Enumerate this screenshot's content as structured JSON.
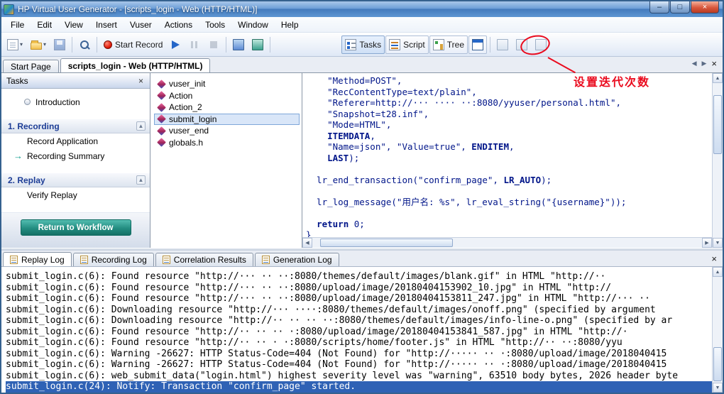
{
  "window": {
    "title": "HP Virtual User Generator - [scripts_login - Web (HTTP/HTML)]"
  },
  "glyphs": {
    "minimize": "–",
    "maximize": "□",
    "close": "×",
    "dropdown": "▾",
    "tab_back": "◀",
    "tab_forward": "▶",
    "collapse": "▲",
    "current_arrow": "→",
    "scroll_up": "▲",
    "scroll_down": "▼",
    "scroll_left": "◀",
    "scroll_right": "▶"
  },
  "menu": {
    "items": [
      "File",
      "Edit",
      "View",
      "Insert",
      "Vuser",
      "Actions",
      "Tools",
      "Window",
      "Help"
    ]
  },
  "toolbar": {
    "start_record_label": "Start Record",
    "tasks_label": "Tasks",
    "script_label": "Script",
    "tree_label": "Tree",
    "annotation_text": "设置迭代次数",
    "annotation_color": "#ea0b1e"
  },
  "document_tabs": [
    {
      "label": "Start Page",
      "active": false
    },
    {
      "label": "scripts_login - Web (HTTP/HTML)",
      "active": true
    }
  ],
  "tasks_panel": {
    "title": "Tasks",
    "entries": [
      {
        "type": "item",
        "label": "Introduction",
        "icon": "intro"
      },
      {
        "type": "section",
        "label": "1. Recording"
      },
      {
        "type": "item",
        "label": "Record Application"
      },
      {
        "type": "item",
        "label": "Recording Summary",
        "current": true
      },
      {
        "type": "section",
        "label": "2. Replay"
      },
      {
        "type": "item",
        "label": "Verify Replay"
      }
    ],
    "workflow_button_label": "Return to Workflow"
  },
  "script_files": [
    {
      "name": "vuser_init",
      "selected": false
    },
    {
      "name": "Action",
      "selected": false
    },
    {
      "name": "Action_2",
      "selected": false
    },
    {
      "name": "submit_login",
      "selected": true
    },
    {
      "name": "vuser_end",
      "selected": false
    },
    {
      "name": "globals.h",
      "selected": false
    }
  ],
  "editor": {
    "keywords": [
      "ITEMDATA",
      "ENDITEM",
      "LAST",
      "LR_AUTO",
      "return"
    ],
    "lines": [
      "    \"Method=POST\",",
      "    \"RecContentType=text/plain\",",
      "    \"Referer=http://··· ···· ··:8080/yyuser/personal.html\",",
      "    \"Snapshot=t28.inf\",",
      "    \"Mode=HTML\",",
      "    ITEMDATA,",
      "    \"Name=json\", \"Value=true\", ENDITEM,",
      "    LAST);",
      "",
      "  lr_end_transaction(\"confirm_page\", LR_AUTO);",
      "",
      "  lr_log_message(\"用户名: %s\", lr_eval_string(\"{username}\"));",
      "",
      "  return 0;",
      "}"
    ]
  },
  "log_panel": {
    "tabs": [
      {
        "label": "Replay Log",
        "active": true
      },
      {
        "label": "Recording Log",
        "active": false
      },
      {
        "label": "Correlation Results",
        "active": false
      },
      {
        "label": "Generation Log",
        "active": false
      }
    ],
    "selected_index": 10,
    "lines": [
      "submit_login.c(6): Found resource \"http://··· ·· ··:8080/themes/default/images/blank.gif\" in HTML \"http://··",
      "submit_login.c(6): Found resource \"http://··· ·· ··:8080/upload/image/20180404153902_10.jpg\" in HTML \"http://",
      "submit_login.c(6): Found resource \"http://··· ·· ··:8080/upload/image/20180404153811_247.jpg\" in HTML \"http://··· ··",
      "submit_login.c(6): Downloading resource \"http://··· ····:8080/themes/default/images/onoff.png\" (specified by argument",
      "submit_login.c(6): Downloading resource \"http://·· ·· ·· ··:8080/themes/default/images/info-line-o.png\" (specified by ar",
      "submit_login.c(6): Found resource \"http://·· ·· ·· ·:8080/upload/image/20180404153841_587.jpg\" in HTML \"http://·",
      "submit_login.c(6): Found resource \"http://·· ·· · ·:8080/scripts/home/footer.js\" in HTML \"http://·· ··:8080/yyu",
      "submit_login.c(6): Warning -26627: HTTP Status-Code=404 (Not Found) for \"http://····· ·· ·:8080/upload/image/2018040415",
      "submit_login.c(6): Warning -26627: HTTP Status-Code=404 (Not Found) for \"http://····· ·· ·:8080/upload/image/2018040415",
      "submit_login.c(6): web_submit_data(\"login.html\") highest severity level was \"warning\", 63510 body bytes, 2026 header byte",
      "submit_login.c(24): Notify: Transaction \"confirm_page\" started."
    ]
  }
}
